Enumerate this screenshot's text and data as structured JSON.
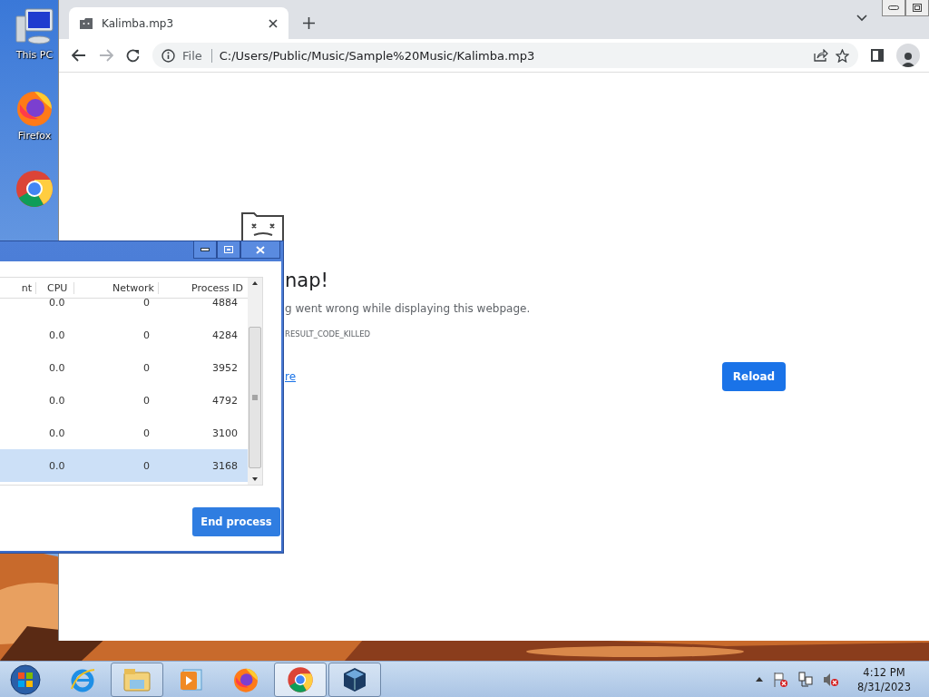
{
  "desktop": {
    "icons": [
      {
        "kind": "computer",
        "label": "This PC"
      },
      {
        "kind": "firefox",
        "label": "Firefox"
      },
      {
        "kind": "chrome"
      }
    ]
  },
  "browser": {
    "tab": {
      "title": "Kalimba.mp3",
      "selected": true
    },
    "address": {
      "scheme": "File",
      "url": "C:/Users/Public/Music/Sample%20Music/Kalimba.mp3"
    },
    "error_page": {
      "heading": "nap!",
      "message": "g went wrong while displaying this webpage.",
      "error_code": "RESULT_CODE_KILLED",
      "link": "re",
      "button": "Reload"
    }
  },
  "task_manager": {
    "columns": [
      "nt",
      "CPU",
      "Network",
      "Process ID"
    ],
    "rows": [
      {
        "cpu": "0.0",
        "network": "0",
        "process_id": "4884",
        "selected": false
      },
      {
        "cpu": "0.0",
        "network": "0",
        "process_id": "4284",
        "selected": false
      },
      {
        "cpu": "0.0",
        "network": "0",
        "process_id": "3952",
        "selected": false
      },
      {
        "cpu": "0.0",
        "network": "0",
        "process_id": "4792",
        "selected": false
      },
      {
        "cpu": "0.0",
        "network": "0",
        "process_id": "3100",
        "selected": false
      },
      {
        "cpu": "0.0",
        "network": "0",
        "process_id": "3168",
        "selected": true
      }
    ],
    "button": "End process"
  },
  "taskbar": {
    "apps": [
      {
        "kind": "ie",
        "running": false,
        "selected": false
      },
      {
        "kind": "explorer",
        "running": true,
        "selected": false
      },
      {
        "kind": "media",
        "running": false,
        "selected": false
      },
      {
        "kind": "firefox",
        "running": false,
        "selected": false
      },
      {
        "kind": "chrome",
        "running": true,
        "selected": true
      },
      {
        "kind": "virtualbox",
        "running": true,
        "selected": false
      }
    ],
    "clock": {
      "time": "4:12 PM",
      "date": "8/31/2023"
    }
  }
}
